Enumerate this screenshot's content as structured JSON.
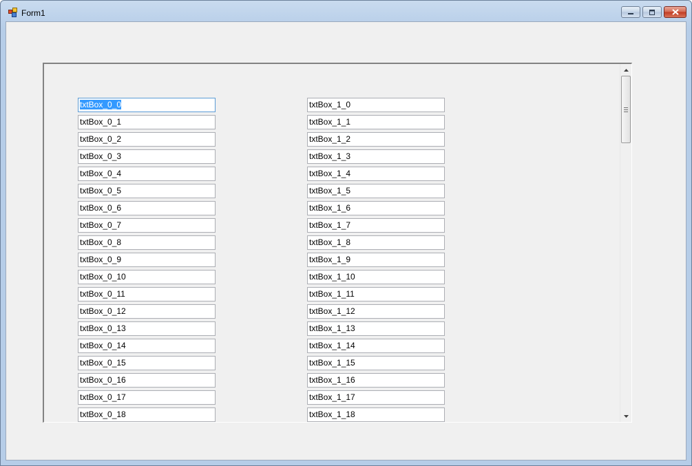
{
  "window": {
    "title": "Form1"
  },
  "textboxes": {
    "col0": [
      "txtBox_0_0",
      "txtBox_0_1",
      "txtBox_0_2",
      "txtBox_0_3",
      "txtBox_0_4",
      "txtBox_0_5",
      "txtBox_0_6",
      "txtBox_0_7",
      "txtBox_0_8",
      "txtBox_0_9",
      "txtBox_0_10",
      "txtBox_0_11",
      "txtBox_0_12",
      "txtBox_0_13",
      "txtBox_0_14",
      "txtBox_0_15",
      "txtBox_0_16",
      "txtBox_0_17",
      "txtBox_0_18"
    ],
    "col1": [
      "txtBox_1_0",
      "txtBox_1_1",
      "txtBox_1_2",
      "txtBox_1_3",
      "txtBox_1_4",
      "txtBox_1_5",
      "txtBox_1_6",
      "txtBox_1_7",
      "txtBox_1_8",
      "txtBox_1_9",
      "txtBox_1_10",
      "txtBox_1_11",
      "txtBox_1_12",
      "txtBox_1_13",
      "txtBox_1_14",
      "txtBox_1_15",
      "txtBox_1_16",
      "txtBox_1_17",
      "txtBox_1_18"
    ]
  },
  "icons": {
    "app": "app-icon",
    "minimize": "minimize-icon",
    "maximize": "maximize-icon",
    "close": "close-icon",
    "scroll_up": "scroll-up-arrow-icon",
    "scroll_down": "scroll-down-arrow-icon",
    "grip": "scrollbar-grip-icon"
  },
  "colors": {
    "selection": "#3399ff",
    "client_bg": "#f0f0f0",
    "close_button": "#c03a22"
  }
}
